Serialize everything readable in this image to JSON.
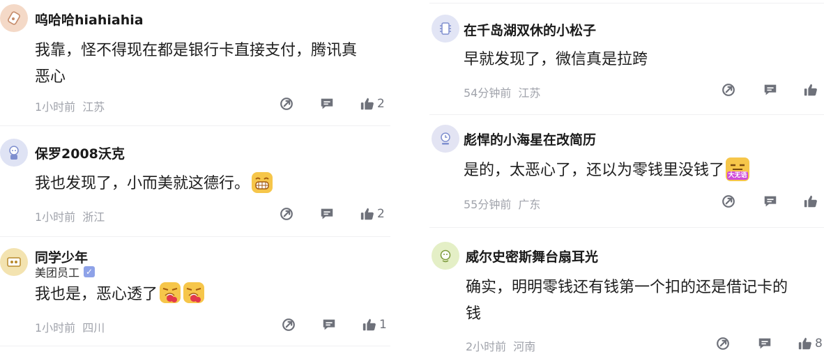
{
  "left_comments": [
    {
      "username": "呜哈哈hiahiahia",
      "content_lines": [
        "我靠，怪不得现在都是银行卡直接支付，腾讯真",
        "恶心"
      ],
      "time": "1小时前",
      "location": "江苏",
      "likes": "2",
      "avatar_color": "#f4d9c7"
    },
    {
      "username": "保罗2008沃克",
      "content": "我也发现了，小而美就这德行。",
      "time": "1小时前",
      "location": "浙江",
      "likes": "2",
      "avatar_color": "#dfe3f4"
    },
    {
      "username": "同学少年",
      "badge": "美团员工",
      "content": "我也是，恶心透了",
      "time": "1小时前",
      "location": "四川",
      "likes": "1",
      "avatar_color": "#f3e3b0"
    }
  ],
  "right_comments": [
    {
      "username": "在千岛湖双休的小松子",
      "content": "早就发现了，微信真是拉跨",
      "time": "54分钟前",
      "location": "江苏",
      "likes": "",
      "avatar_color": "#e2e5f5"
    },
    {
      "username": "彪悍的小海星在改简历",
      "content": "是的，太恶心了，还以为零钱里没钱了",
      "sticker_text": "大无语",
      "time": "55分钟前",
      "location": "广东",
      "likes": "",
      "avatar_color": "#e3e4f3"
    },
    {
      "username": "威尔史密斯舞台扇耳光",
      "content_lines": [
        "确实，明明零钱还有钱第一个扣的还是借记卡的",
        "钱"
      ],
      "time": "2小时前",
      "location": "河南",
      "likes": "8",
      "avatar_color": "#e4efc6"
    }
  ],
  "icons": {
    "share": "share-icon",
    "reply": "comment-icon",
    "like": "thumbs-up-icon"
  },
  "colors": {
    "meta": "#a0a3ab",
    "icon": "#6e717a",
    "verify": "#8ea2e8"
  }
}
